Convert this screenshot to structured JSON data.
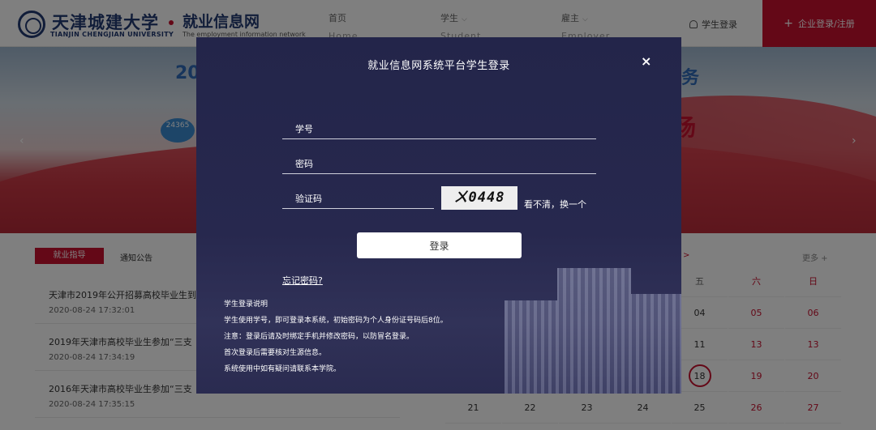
{
  "header": {
    "logo_cn": "天津城建大学",
    "logo_en": "TIANJIN CHENGJIAN UNIVERSITY",
    "site_cn": "就业信息网",
    "site_en": "The employment information network",
    "nav": [
      {
        "cn": "首页",
        "en": "Home"
      },
      {
        "cn": "学生",
        "en": "Student"
      },
      {
        "cn": "雇主",
        "en": "Employer"
      }
    ],
    "student_login": "学生登录",
    "corp_login": "企业登录/注册"
  },
  "banner": {
    "title_left": "20",
    "title_right": "务",
    "sub_right": "场",
    "badge": "24365"
  },
  "content": {
    "tabs": [
      "就业指导",
      "通知公告"
    ],
    "news": [
      {
        "title": "天津市2019年公开招募高校毕业生到",
        "date": "2020-08-24 17:32:01"
      },
      {
        "title": "2019年天津市高校毕业生参加“三支",
        "date": "2020-08-24 17:34:19"
      },
      {
        "title": "2016年天津市高校毕业生参加“三支",
        "date": "2020-08-24 17:35:15"
      }
    ]
  },
  "calendar": {
    "more": "更多 +",
    "prev": ">",
    "headers": [
      "五",
      "六",
      "日"
    ],
    "rows": [
      [
        "04",
        "05",
        "06"
      ],
      [
        "11",
        "13",
        "13"
      ],
      [
        "18",
        "19",
        "20"
      ]
    ],
    "bottom_row": [
      "21",
      "22",
      "23",
      "24",
      "25",
      "26",
      "27"
    ],
    "today": "18"
  },
  "modal": {
    "title": "就业信息网系统平台学生登录",
    "close": "×",
    "student_id_placeholder": "学号",
    "password_placeholder": "密码",
    "captcha_placeholder": "验证码",
    "captcha_text": "ㄨ0448",
    "captcha_refresh": "看不清，换一个",
    "login_button": "登录",
    "forgot_password": "忘记密码?",
    "notes": [
      "学生登录说明",
      "学生使用学号，即可登录本系统，初始密码为个人身份证号码后8位。",
      "注意：登录后请及时绑定手机并修改密码，以防冒名登录。",
      "首次登录后需要核对生源信息。",
      "系统使用中如有疑问请联系本学院。"
    ]
  },
  "colors": {
    "brand_red": "#c8102e",
    "brand_blue": "#233a73",
    "modal_bg": "#23254a"
  }
}
